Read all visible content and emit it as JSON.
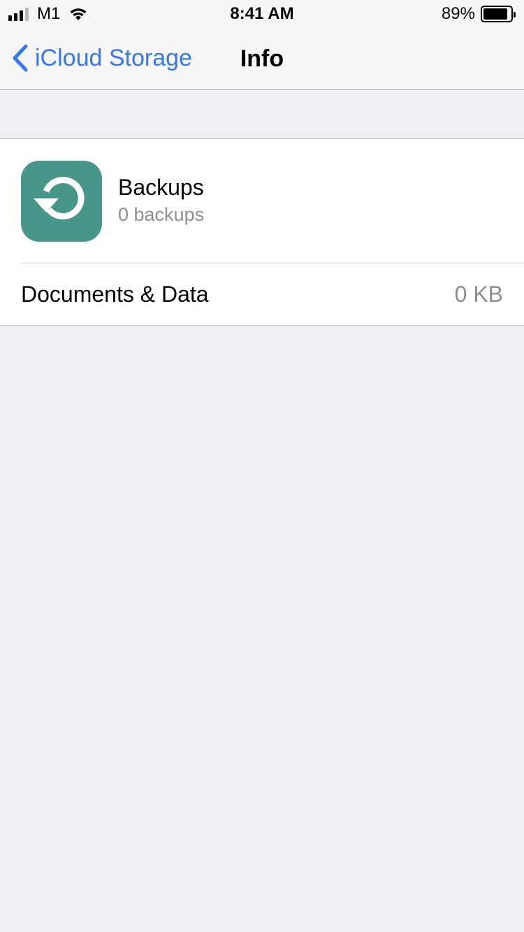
{
  "status_bar": {
    "carrier": "M1",
    "time": "8:41 AM",
    "battery_percent": "89%",
    "battery_level": 0.89,
    "signal_bars": 3,
    "signal_total": 4,
    "wifi": "wifi-icon"
  },
  "nav": {
    "back_label": "iCloud Storage",
    "title": "Info"
  },
  "list": {
    "backups": {
      "icon": "backup-restore-icon",
      "title": "Backups",
      "subtitle": "0 backups"
    },
    "documents": {
      "label": "Documents & Data",
      "value": "0 KB"
    }
  },
  "colors": {
    "accent": "#3478f6",
    "icon_background": "#479689",
    "secondary_text": "#8e8e93",
    "grouped_background": "#efeff4"
  }
}
